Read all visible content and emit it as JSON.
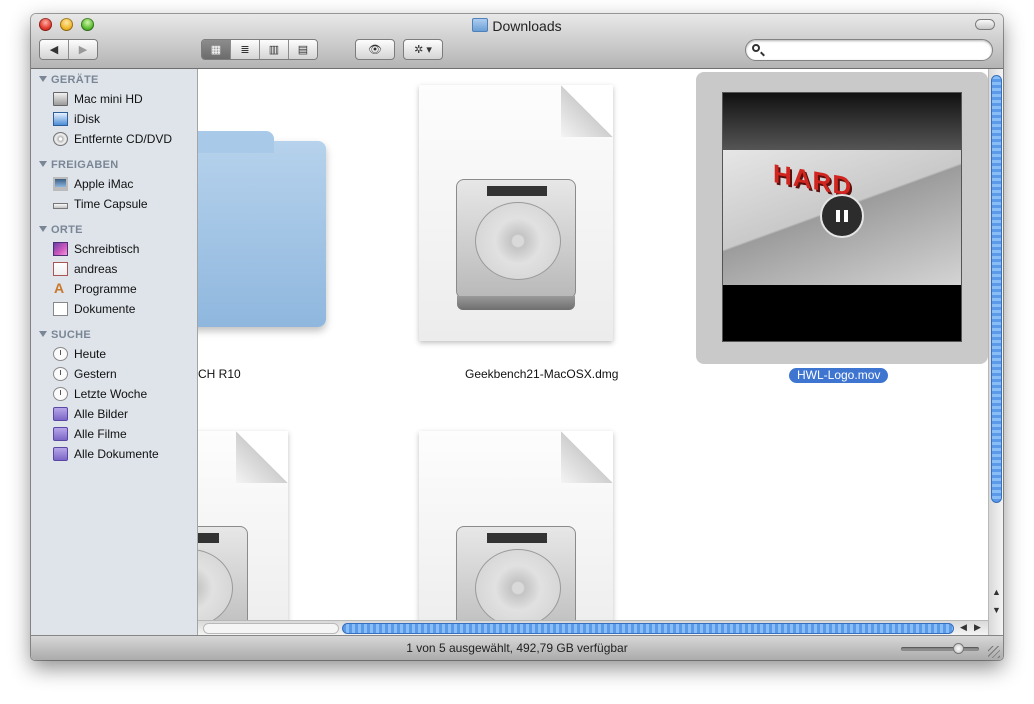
{
  "window": {
    "title": "Downloads"
  },
  "toolbar": {
    "back_label": "◀",
    "forward_label": "▶",
    "view_icon_label": "▦",
    "view_list_label": "≣",
    "view_columns_label": "▥",
    "view_coverflow_label": "▤",
    "quicklook_label": "👁",
    "action_label": "✲ ▾",
    "search": {
      "value": "",
      "placeholder": ""
    }
  },
  "sidebar": {
    "sections": [
      {
        "label": "GERÄTE",
        "items": [
          {
            "label": "Mac mini HD",
            "icon": "hard-drive-icon"
          },
          {
            "label": "iDisk",
            "icon": "idisk-icon"
          },
          {
            "label": "Entfernte CD/DVD",
            "icon": "cd-icon"
          }
        ]
      },
      {
        "label": "FREIGABEN",
        "items": [
          {
            "label": "Apple iMac",
            "icon": "imac-icon"
          },
          {
            "label": "Time Capsule",
            "icon": "time-capsule-icon"
          }
        ]
      },
      {
        "label": "ORTE",
        "items": [
          {
            "label": "Schreibtisch",
            "icon": "desktop-icon"
          },
          {
            "label": "andreas",
            "icon": "home-icon"
          },
          {
            "label": "Programme",
            "icon": "applications-icon"
          },
          {
            "label": "Dokumente",
            "icon": "documents-icon"
          }
        ]
      },
      {
        "label": "SUCHE",
        "items": [
          {
            "label": "Heute",
            "icon": "clock-icon"
          },
          {
            "label": "Gestern",
            "icon": "clock-icon"
          },
          {
            "label": "Letzte Woche",
            "icon": "clock-icon"
          },
          {
            "label": "Alle Bilder",
            "icon": "smart-folder-icon"
          },
          {
            "label": "Alle Filme",
            "icon": "smart-folder-icon"
          },
          {
            "label": "Alle Dokumente",
            "icon": "smart-folder-icon"
          }
        ]
      }
    ]
  },
  "files": [
    {
      "name": "CH R10",
      "kind": "folder"
    },
    {
      "name": "Geekbench21-MacOSX.dmg",
      "kind": "disk-image"
    },
    {
      "name": "HWL-Logo.mov",
      "kind": "movie",
      "selected": true,
      "preview_text": "HARD"
    },
    {
      "name": "",
      "kind": "disk-image"
    },
    {
      "name": "",
      "kind": "disk-image"
    }
  ],
  "status": {
    "text": "1 von 5 ausgewählt, 492,79 GB verfügbar"
  },
  "colors": {
    "selection": "#3e75d1",
    "sidebar_bg": "#dee4ea",
    "scroll_thumb": "#5a9ae8"
  }
}
